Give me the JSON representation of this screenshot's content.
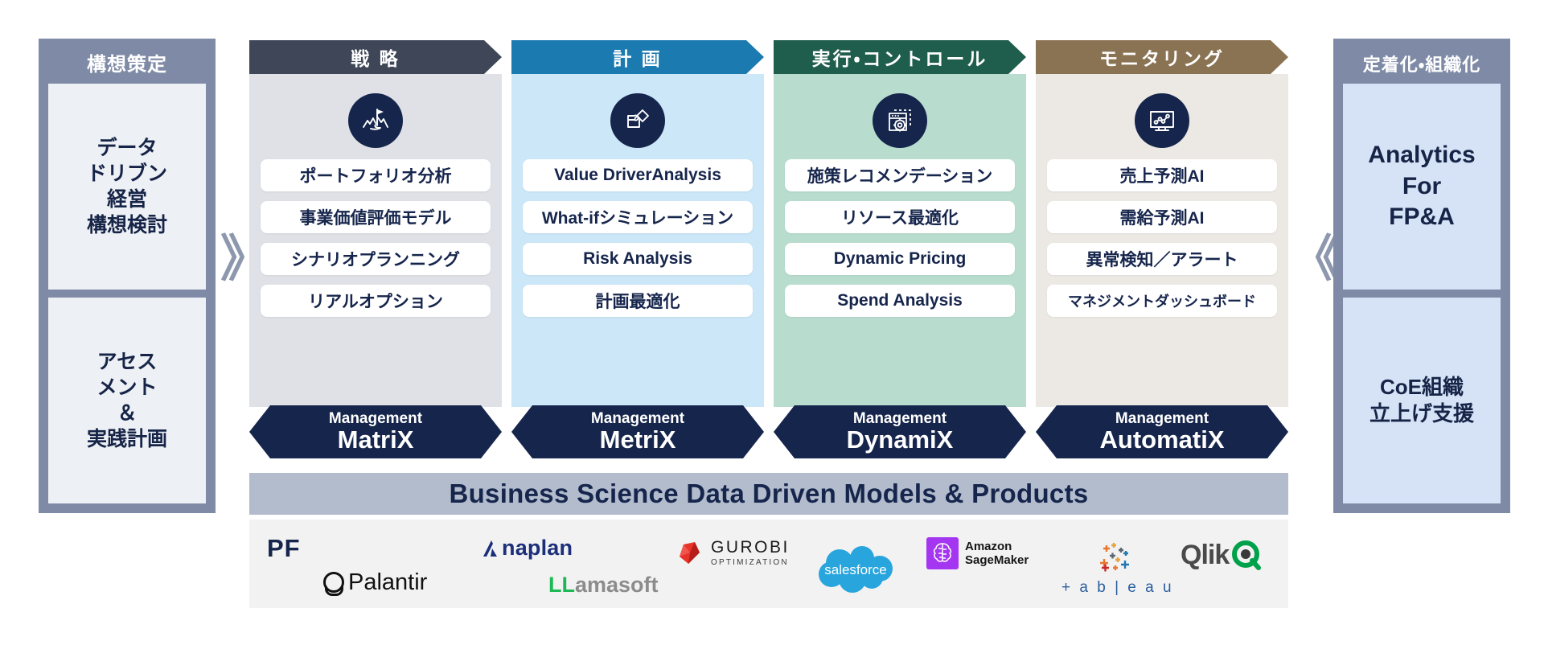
{
  "left_rail": {
    "title": "構想策定",
    "cells": [
      {
        "name": "data-driven-management-concept",
        "text": "データ\nドリブン\n経営\n構想検討"
      },
      {
        "name": "assessment-and-practice-plan",
        "text": "アセス\nメント\n＆\n実践計画"
      }
    ]
  },
  "right_rail": {
    "title": "定着化・組織化",
    "cells": [
      {
        "name": "analytics-for-fpa",
        "text": "Analytics\nFor\nFP&A"
      },
      {
        "name": "coe-org-launch-support",
        "text": "CoE組織\n立上げ支援"
      }
    ]
  },
  "separators": {
    "left_chevron": "》",
    "right_chevron": "《"
  },
  "phases": [
    {
      "key": "strategy",
      "header": "戦 略",
      "header_color": "#3e4657",
      "body_color": "#dfe1e6",
      "icon": "mountain-flag-icon",
      "items": [
        "ポートフォリオ分析",
        "事業価値評価モデル",
        "シナリオプランニング",
        "リアルオプション"
      ],
      "product": {
        "prefix": "Management",
        "name": "MatriX"
      }
    },
    {
      "key": "planning",
      "header": "計 画",
      "header_color": "#1b7ab0",
      "body_color": "#cbe7f8",
      "icon": "puzzle-piece-icon",
      "items": [
        "Value DriverAnalysis",
        "What-ifシミュレーション",
        "Risk Analysis",
        "計画最適化"
      ],
      "product": {
        "prefix": "Management",
        "name": "MetriX"
      }
    },
    {
      "key": "execution-control",
      "header": "実行・コントロール",
      "header_color": "#1f5d4c",
      "body_color": "#b8ddcf",
      "icon": "window-gear-icon",
      "items": [
        "施策レコメンデーション",
        "リソース最適化",
        "Dynamic Pricing",
        "Spend Analysis"
      ],
      "product": {
        "prefix": "Management",
        "name": "DynamiX"
      }
    },
    {
      "key": "monitoring",
      "header": "モニタリング",
      "header_color": "#8a7352",
      "body_color": "#ece9e4",
      "icon": "monitor-chart-icon",
      "items": [
        "売上予測AI",
        "需給予測AI",
        "異常検知／アラート",
        "マネジメントダッシュボード"
      ],
      "product": {
        "prefix": "Management",
        "name": "AutomatiX"
      }
    }
  ],
  "platform_band": {
    "title": "Business Science Data Driven Models & Products"
  },
  "logos": {
    "pf": "PF",
    "palantir": "Palantir",
    "anaplan": "naplan",
    "llamasoft_prefix": "LL",
    "llamasoft_suffix": "amasoft",
    "gurobi_name": "GUROBI",
    "gurobi_sub": "OPTIMIZATION",
    "salesforce": "salesforce",
    "sagemaker_line1": "Amazon",
    "sagemaker_line2": "SageMaker",
    "tableau": "+ a b | e a u",
    "qlik": "Qlik"
  },
  "colors": {
    "rail": "#7f8ba6",
    "rail_cell_left": "#edf0f4",
    "rail_cell_right": "#d6e2f5",
    "product_navy": "#16254c",
    "platform_band": "#b3bccd",
    "logo_band": "#f2f2f2"
  }
}
